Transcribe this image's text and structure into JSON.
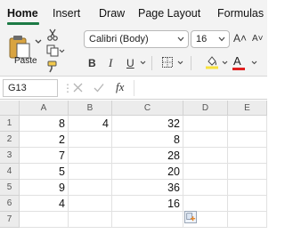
{
  "tabs": [
    {
      "label": "Home",
      "active": true
    },
    {
      "label": "Insert",
      "active": false
    },
    {
      "label": "Draw",
      "active": false
    },
    {
      "label": "Page Layout",
      "active": false
    },
    {
      "label": "Formulas",
      "active": false
    }
  ],
  "ribbon": {
    "paste_label": "Paste",
    "font_name": "Calibri (Body)",
    "font_size": "16",
    "grow_font": "A˄",
    "shrink_font": "A˅",
    "bold": "B",
    "italic": "I",
    "underline": "U",
    "font_color_glyph": "A",
    "fill_color": "#f7e13b",
    "font_color": "#e02020"
  },
  "formula_bar": {
    "name_box": "G13",
    "fx": "fx",
    "formula": ""
  },
  "sheet": {
    "columns": [
      "A",
      "B",
      "C",
      "D",
      "E"
    ],
    "rows": [
      "1",
      "2",
      "3",
      "4",
      "5",
      "6",
      "7"
    ],
    "cells": {
      "A1": "8",
      "B1": "4",
      "C1": "32",
      "A2": "2",
      "C2": "8",
      "A3": "7",
      "C3": "28",
      "A4": "5",
      "C4": "20",
      "A5": "9",
      "C5": "36",
      "A6": "4",
      "C6": "16"
    }
  },
  "icons": [
    "paste-icon",
    "cut-icon",
    "copy-icon",
    "format-painter-icon",
    "borders-icon",
    "fill-color-icon",
    "font-color-icon",
    "cancel-icon",
    "enter-icon",
    "paste-options-icon"
  ]
}
